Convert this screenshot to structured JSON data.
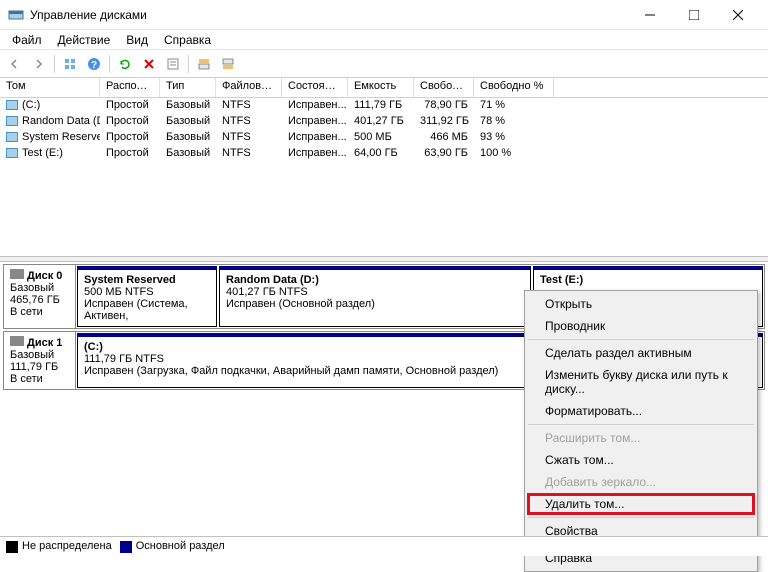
{
  "window": {
    "title": "Управление дисками"
  },
  "menus": {
    "file": "Файл",
    "action": "Действие",
    "view": "Вид",
    "help": "Справка"
  },
  "columns": {
    "tom": "Том",
    "loc": "Располо...",
    "type": "Тип",
    "fs": "Файловая с...",
    "state": "Состояние",
    "cap": "Емкость",
    "free": "Свобод...",
    "freepct": "Свободно %"
  },
  "volumes": [
    {
      "name": "(C:)",
      "loc": "Простой",
      "type": "Базовый",
      "fs": "NTFS",
      "state": "Исправен...",
      "cap": "111,79 ГБ",
      "free": "78,90 ГБ",
      "freepct": "71 %"
    },
    {
      "name": "Random Data (D:)",
      "loc": "Простой",
      "type": "Базовый",
      "fs": "NTFS",
      "state": "Исправен...",
      "cap": "401,27 ГБ",
      "free": "311,92 ГБ",
      "freepct": "78 %"
    },
    {
      "name": "System Reserved",
      "loc": "Простой",
      "type": "Базовый",
      "fs": "NTFS",
      "state": "Исправен...",
      "cap": "500 МБ",
      "free": "466 МБ",
      "freepct": "93 %"
    },
    {
      "name": "Test (E:)",
      "loc": "Простой",
      "type": "Базовый",
      "fs": "NTFS",
      "state": "Исправен...",
      "cap": "64,00 ГБ",
      "free": "63,90 ГБ",
      "freepct": "100 %"
    }
  ],
  "disk0": {
    "name": "Диск 0",
    "type": "Базовый",
    "size": "465,76 ГБ",
    "status": "В сети",
    "p1": {
      "name": "System Reserved",
      "info": "500 МБ NTFS",
      "state": "Исправен (Система, Активен,"
    },
    "p2": {
      "name": "Random Data  (D:)",
      "info": "401,27 ГБ NTFS",
      "state": "Исправен (Основной раздел)"
    },
    "p3": {
      "name": "Test  (E:)"
    }
  },
  "disk1": {
    "name": "Диск 1",
    "type": "Базовый",
    "size": "111,79 ГБ",
    "status": "В сети",
    "p1": {
      "name": "(C:)",
      "info": "111,79 ГБ NTFS",
      "state": "Исправен (Загрузка, Файл подкачки, Аварийный дамп памяти, Основной раздел)"
    }
  },
  "ctx": {
    "open": "Открыть",
    "explorer": "Проводник",
    "active": "Сделать раздел активным",
    "changeletter": "Изменить букву диска или путь к диску...",
    "format": "Форматировать...",
    "extend": "Расширить том...",
    "shrink": "Сжать том...",
    "mirror": "Добавить зеркало...",
    "delete": "Удалить том...",
    "props": "Свойства",
    "help": "Справка"
  },
  "legend": {
    "unalloc": "Не распределена",
    "primary": "Основной раздел"
  }
}
